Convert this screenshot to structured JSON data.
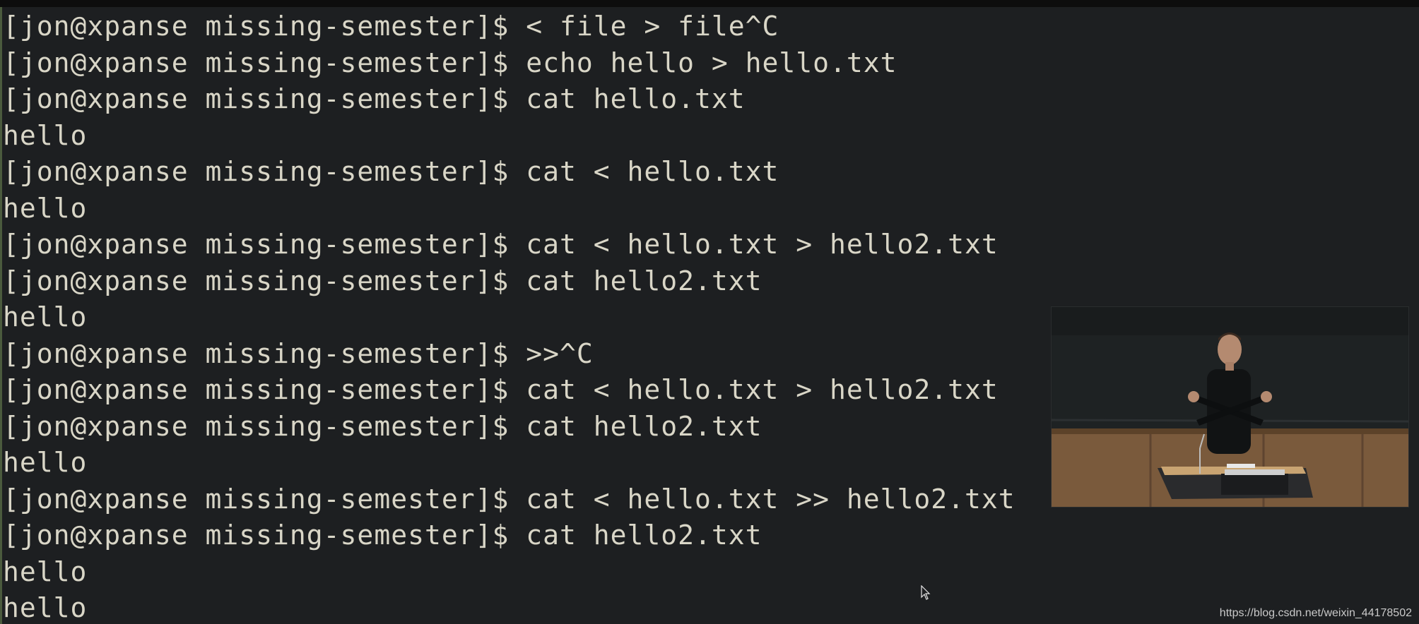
{
  "terminal": {
    "lines": [
      {
        "text": "[jon@xpanse missing-semester]$ < file > file^C"
      },
      {
        "text": "[jon@xpanse missing-semester]$ echo hello > hello.txt"
      },
      {
        "text": "[jon@xpanse missing-semester]$ cat hello.txt"
      },
      {
        "text": "hello"
      },
      {
        "text": "[jon@xpanse missing-semester]$ cat < hello.txt"
      },
      {
        "text": "hello"
      },
      {
        "text": "[jon@xpanse missing-semester]$ cat < hello.txt > hello2.txt"
      },
      {
        "text": "[jon@xpanse missing-semester]$ cat hello2.txt"
      },
      {
        "text": "hello"
      },
      {
        "text": "[jon@xpanse missing-semester]$ >>^C"
      },
      {
        "text": "[jon@xpanse missing-semester]$ cat < hello.txt > hello2.txt"
      },
      {
        "text": "[jon@xpanse missing-semester]$ cat hello2.txt"
      },
      {
        "text": "hello"
      },
      {
        "text": "[jon@xpanse missing-semester]$ cat < hello.txt >> hello2.txt"
      },
      {
        "text": "[jon@xpanse missing-semester]$ cat hello2.txt"
      },
      {
        "text": "hello"
      },
      {
        "text": "hello"
      }
    ]
  },
  "watermark": "https://blog.csdn.net/weixin_44178502",
  "colors": {
    "background": "#1d1f21",
    "text": "#d9d6c7"
  },
  "icons": {
    "cursor": "mouse-pointer-icon"
  }
}
